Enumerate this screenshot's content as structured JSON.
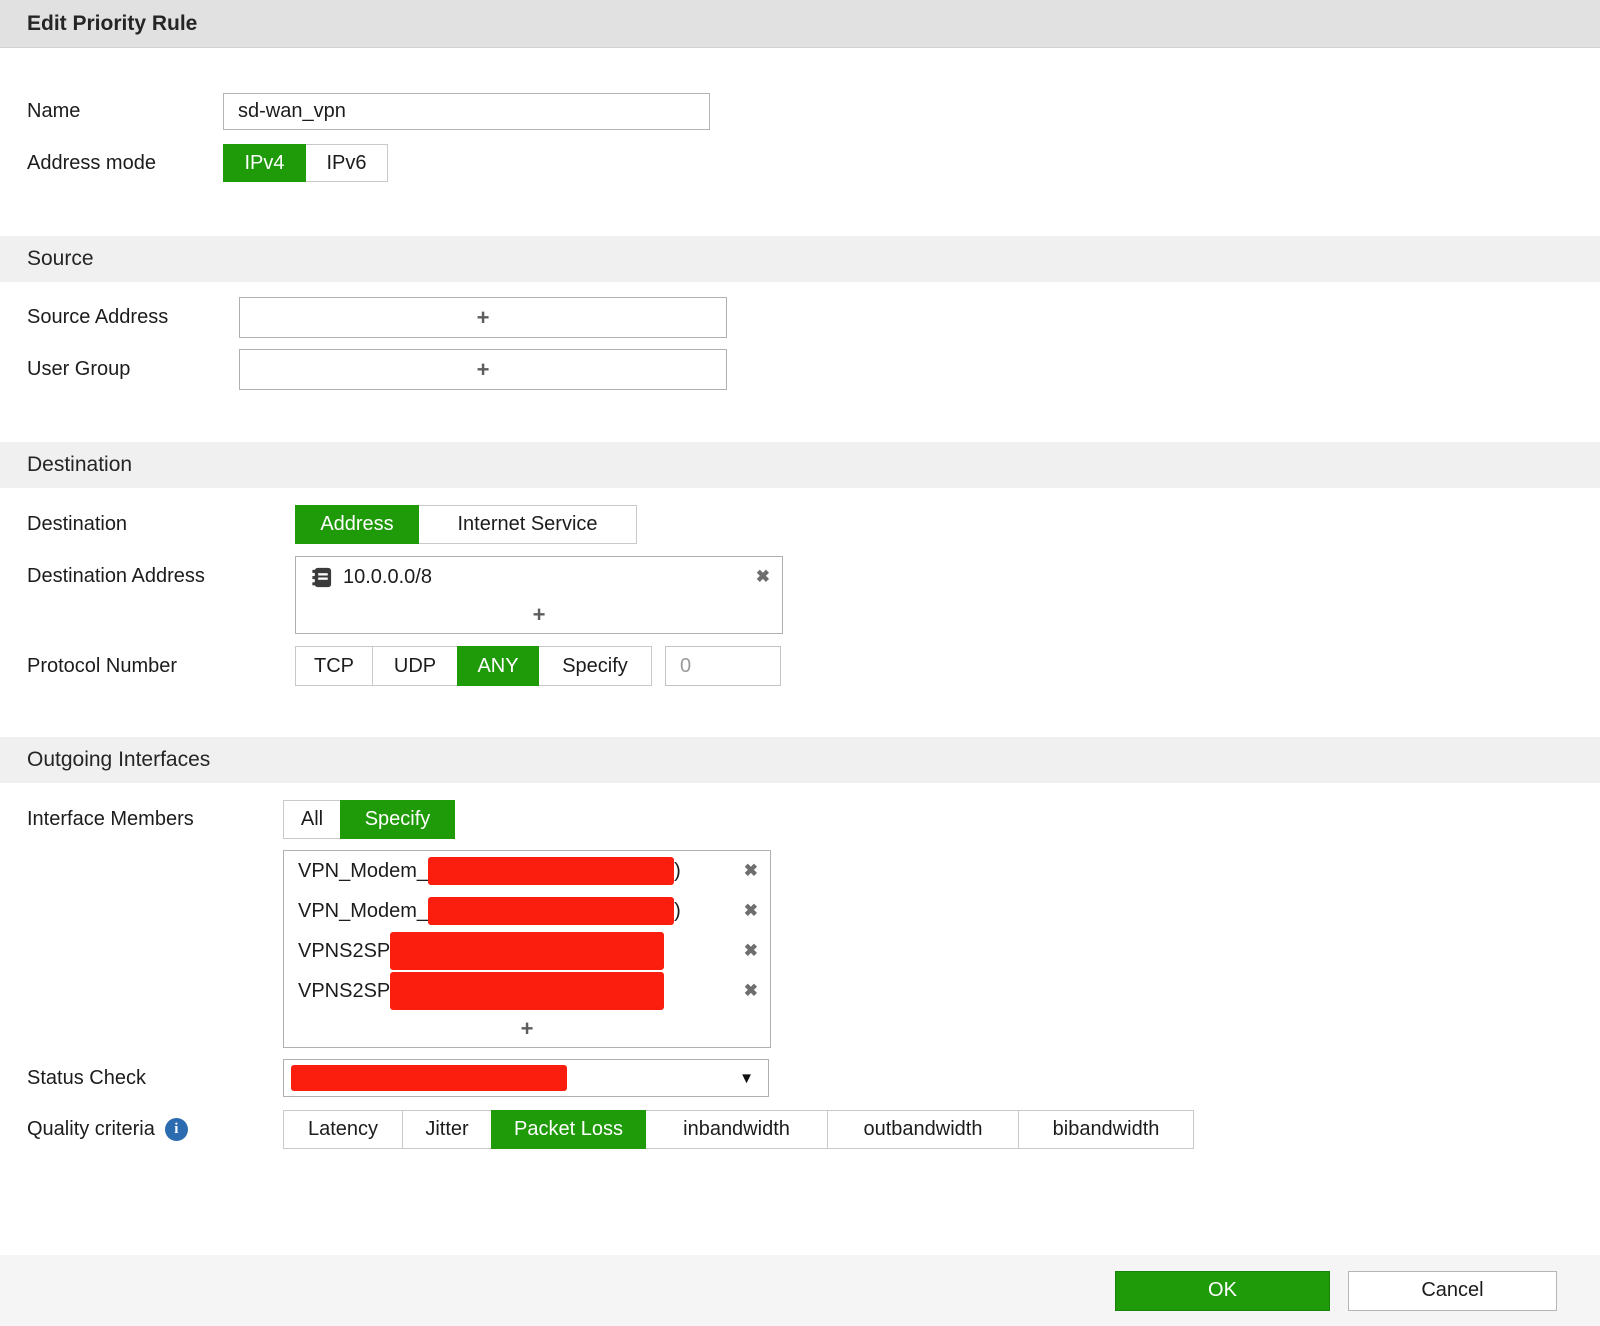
{
  "title": "Edit Priority Rule",
  "icons": {
    "plus": "+",
    "close": "✖",
    "caret_down": "▼",
    "info": "i"
  },
  "colors": {
    "accent_green": "#1f9a08",
    "redaction_red": "#fb1d0d",
    "info_blue": "#2b6cb0"
  },
  "name_field": {
    "label": "Name",
    "value": "sd-wan_vpn"
  },
  "address_mode": {
    "label": "Address mode",
    "options": [
      "IPv4",
      "IPv6"
    ],
    "selected": "IPv4"
  },
  "source": {
    "heading": "Source",
    "source_address_label": "Source Address",
    "user_group_label": "User Group"
  },
  "destination": {
    "heading": "Destination",
    "destination_label": "Destination",
    "destination_options": [
      "Address",
      "Internet Service"
    ],
    "destination_selected": "Address",
    "destination_address_label": "Destination Address",
    "address_entries": [
      "10.0.0.0/8"
    ],
    "protocol_label": "Protocol Number",
    "protocol_options": [
      "TCP",
      "UDP",
      "ANY",
      "Specify"
    ],
    "protocol_selected": "ANY",
    "protocol_value": "0"
  },
  "outgoing": {
    "heading": "Outgoing Interfaces",
    "interface_members_label": "Interface Members",
    "member_mode_options": [
      "All",
      "Specify"
    ],
    "member_mode_selected": "Specify",
    "members": [
      {
        "prefix": "VPN_Modem_",
        "suffix": ")",
        "redacted": true
      },
      {
        "prefix": "VPN_Modem_",
        "suffix": ")",
        "redacted": true
      },
      {
        "prefix": "VPNS2SP",
        "suffix": "",
        "redacted": true
      },
      {
        "prefix": "VPNS2SP",
        "suffix": "",
        "redacted": true
      }
    ],
    "status_check_label": "Status Check",
    "status_check_value_redacted": true,
    "quality_criteria_label": "Quality criteria",
    "quality_options": [
      "Latency",
      "Jitter",
      "Packet Loss",
      "inbandwidth",
      "outbandwidth",
      "bibandwidth"
    ],
    "quality_selected": "Packet Loss"
  },
  "footer": {
    "ok_label": "OK",
    "cancel_label": "Cancel"
  }
}
